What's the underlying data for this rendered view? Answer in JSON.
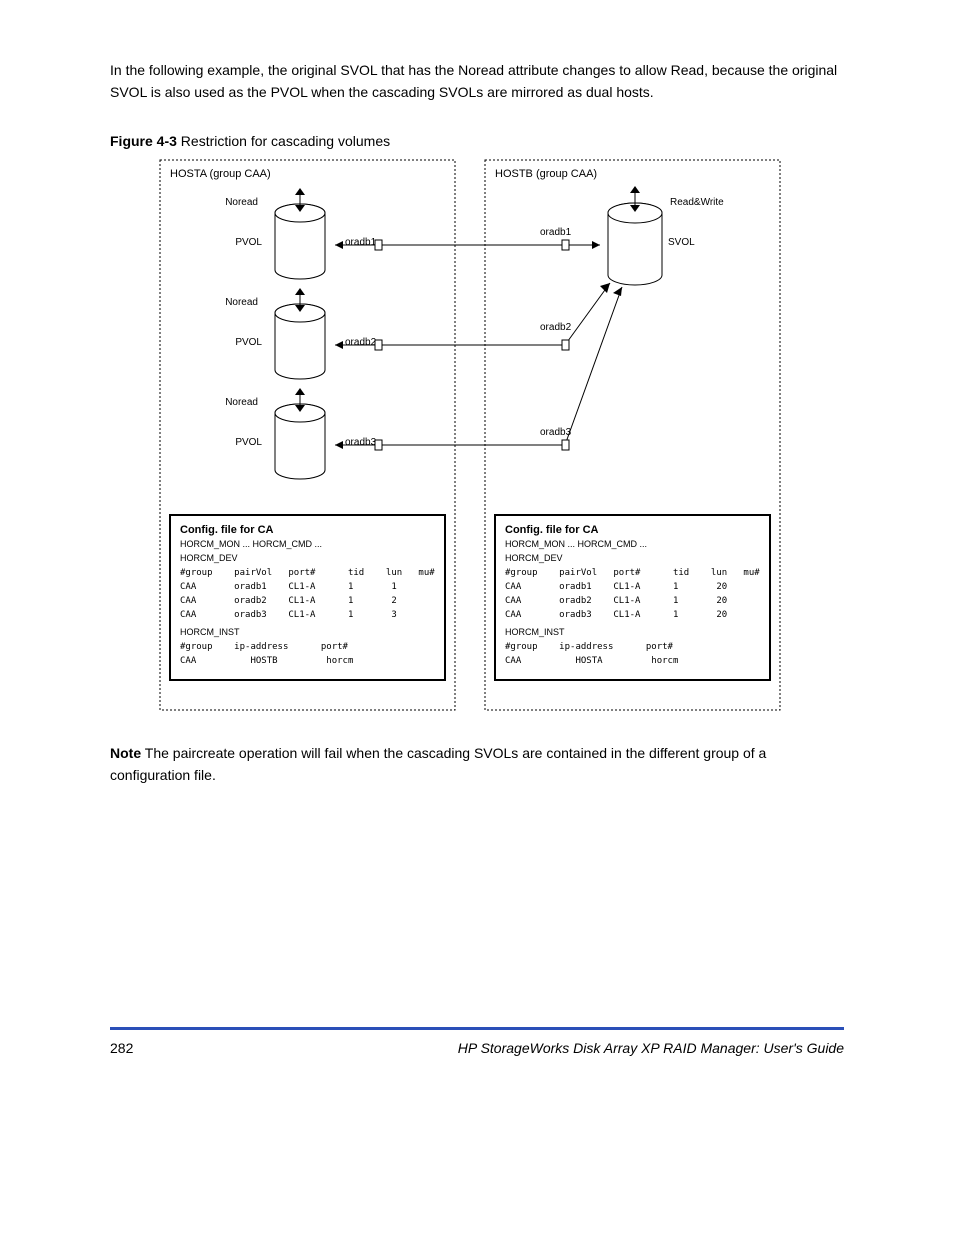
{
  "para1": "In the following example, the original SVOL that has the Noread attribute changes to allow Read, because the original SVOL is also used as the PVOL when the cascading SVOLs are mirrored as dual hosts.",
  "figure_label_prefix": "Figure 4-3",
  "figure_label_rest": "Restriction for cascading volumes",
  "note_prefix": "Note",
  "note_body": "The paircreate operation will fail when the cascading SVOLs are contained in the different group of a configuration file.",
  "hostA": "HOSTA (group CAA)",
  "hostB": "HOSTB (group CAA)",
  "noread": "Noread",
  "readwrite": "Read&Write",
  "pvol": "PVOL",
  "svol": "SVOL",
  "oradb1": "oradb1",
  "oradb2": "oradb2",
  "oradb3": "oradb3",
  "boxA": {
    "title": "Config. file for CA",
    "lines": [
      "HORCM_MON ... HORCM_CMD ...",
      "HORCM_DEV",
      "#group    pairVol   port#      tid    lun   mu#",
      "CAA       oradb1    CL1-A      1       1",
      "CAA       oradb2    CL1-A      1       2",
      "CAA       oradb3    CL1-A      1       3",
      "HORCM_INST",
      "#group    ip-address      port#",
      "CAA          HOSTB         horcm"
    ]
  },
  "boxB": {
    "title": "Config. file for CA",
    "lines": [
      "HORCM_MON ... HORCM_CMD ...",
      "HORCM_DEV",
      "#group    pairVol   port#      tid    lun   mu#",
      "CAA       oradb1    CL1-A      1       20",
      "CAA       oradb2    CL1-A      1       20",
      "CAA       oradb3    CL1-A      1       20",
      "HORCM_INST",
      "#group    ip-address      port#",
      "CAA          HOSTA         horcm"
    ]
  },
  "page_number": "282",
  "guide_title": "HP StorageWorks Disk Array XP RAID Manager: User's Guide"
}
